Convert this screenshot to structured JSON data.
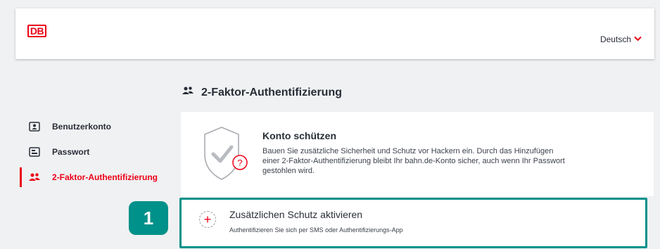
{
  "header": {
    "logo_text": "DB",
    "language_label": "Deutsch",
    "language_chevron": "∨"
  },
  "sidebar": {
    "items": [
      {
        "label": "Benutzerkonto",
        "icon": "user-card-icon",
        "active": false
      },
      {
        "label": "Passwort",
        "icon": "password-icon",
        "active": false
      },
      {
        "label": "2-Faktor-Authentifizierung",
        "icon": "users-icon",
        "active": true
      }
    ]
  },
  "main": {
    "title": "2-Faktor-Authentifizierung",
    "card": {
      "title": "Konto schützen",
      "text": "Bauen Sie zusätzliche Sicherheit und Schutz vor Hackern ein. Durch das Hinzufügen einer 2-Faktor-Authentifizierung bleibt Ihr bahn.de-Konto sicher, auch wenn Ihr Passwort gestohlen wird.",
      "shield_question": "?"
    },
    "action": {
      "plus": "+",
      "title": "Zusätzlichen Schutz aktivieren",
      "subtitle": "Authentifizieren Sie sich per SMS oder Authentifizierungs-App"
    }
  },
  "step_badge": "1",
  "colors": {
    "brand_red": "#ec0016",
    "highlight_teal": "#00918a",
    "background": "#f0f1f2",
    "text": "#282d37"
  }
}
